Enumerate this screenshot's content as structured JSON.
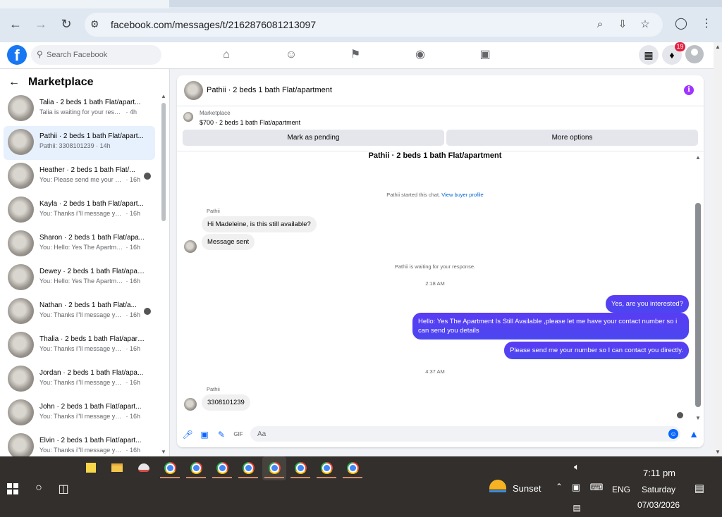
{
  "browser": {
    "url_host": "facebook.com",
    "url_path": "/messages/t/2162876081213097"
  },
  "fb": {
    "search_placeholder": "Search Facebook",
    "notifications_count": "19"
  },
  "sidebar": {
    "title": "Marketplace",
    "conversations": [
      {
        "name": "Talia · 2 beds 1 bath Flat/apart...",
        "snippet": "Talia is waiting for your response.",
        "time": "4h",
        "active": false
      },
      {
        "name": "Pathii · 2 beds 1 bath Flat/apart...",
        "snippet": "Pathii: 3308101239",
        "time": "14h",
        "active": true
      },
      {
        "name": "Heather · 2 beds 1 bath Flat/...",
        "snippet": "You: Please send me your nu...",
        "time": "16h",
        "active": false
      },
      {
        "name": "Kayla · 2 beds 1 bath Flat/apart...",
        "snippet": "You: Thanks i\"ll message you in a...",
        "time": "16h",
        "active": false
      },
      {
        "name": "Sharon · 2 beds 1 bath Flat/apa...",
        "snippet": "You: Hello: Yes The Apartment Is ...",
        "time": "16h",
        "active": false
      },
      {
        "name": "Dewey · 2 beds 1 bath Flat/apart...",
        "snippet": "You: Hello: Yes The Apartment Is ...",
        "time": "16h",
        "active": false
      },
      {
        "name": "Nathan · 2 beds 1 bath Flat/a...",
        "snippet": "You: Thanks i\"ll message you i...",
        "time": "16h",
        "active": false
      },
      {
        "name": "Thalia · 2 beds 1 bath Flat/apart...",
        "snippet": "You: Thanks i\"ll message you in a...",
        "time": "16h",
        "active": false
      },
      {
        "name": "Jordan · 2 beds 1 bath Flat/apa...",
        "snippet": "You: Thanks i\"ll message you in a...",
        "time": "16h",
        "active": false
      },
      {
        "name": "John · 2 beds 1 bath Flat/apart...",
        "snippet": "You: Thanks i\"ll message you in a...",
        "time": "16h",
        "active": false
      },
      {
        "name": "Elvin · 2 beds 1 bath Flat/apart...",
        "snippet": "You: Thanks i\"ll message you in a...",
        "time": "16h",
        "active": false
      }
    ]
  },
  "chat": {
    "header_title": "Pathii · 2 beds 1 bath Flat/apartment",
    "marketplace_label": "Marketplace",
    "listing": "$700 - 2 beds 1 bath Flat/apartment",
    "mark_pending": "Mark as pending",
    "more_options": "More options",
    "thread_title": "Pathii · 2 beds 1 bath Flat/apartment",
    "started_text": "Pathii started this chat.",
    "view_profile": "View buyer profile",
    "sender1": "Pathii",
    "msg1": "Hi Madeleine, is this still available?",
    "msg2": "Message sent",
    "waiting_text": "Pathii is waiting for your response.",
    "time1": "2:18 AM",
    "out1": "Yes, are you interested?",
    "out2": "Hello: Yes The Apartment Is Still Available ,please let me have your contact number so i can send you details",
    "out3": "Please send me your number so I can contact you directly.",
    "time2": "4:37 AM",
    "sender2": "Pathii",
    "msg3": "3308101239",
    "composer_placeholder": "Aa"
  },
  "taskbar": {
    "weather": "Sunset",
    "lang": "ENG",
    "time": "7:11 pm",
    "day": "Saturday",
    "date": "07/03/2026"
  }
}
